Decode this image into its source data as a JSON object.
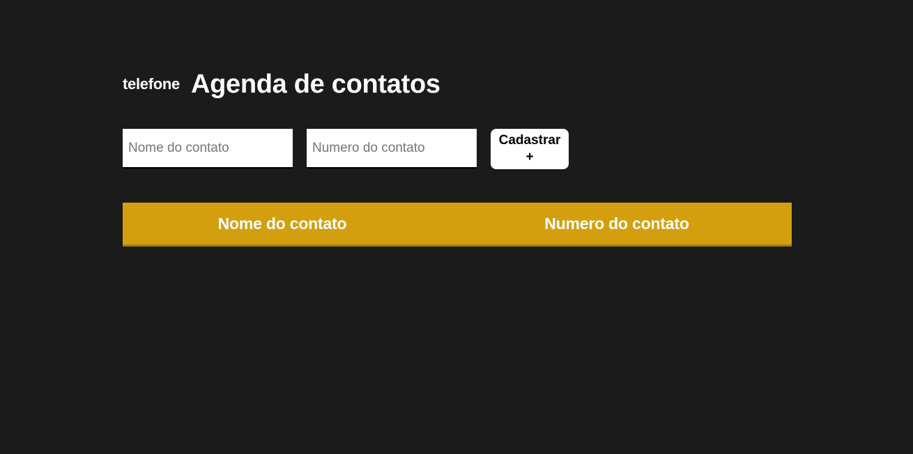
{
  "header": {
    "logo_text": "telefone",
    "title": "Agenda de contatos"
  },
  "form": {
    "name_placeholder": "Nome do contato",
    "number_placeholder": "Numero do contato",
    "submit_label_line1": "Cadastrar",
    "submit_label_line2": "+"
  },
  "table": {
    "columns": [
      "Nome do contato",
      "Numero do contato"
    ],
    "rows": []
  },
  "colors": {
    "background": "#1b1b1b",
    "table_header": "#d39f0f",
    "text": "#ffffff"
  }
}
